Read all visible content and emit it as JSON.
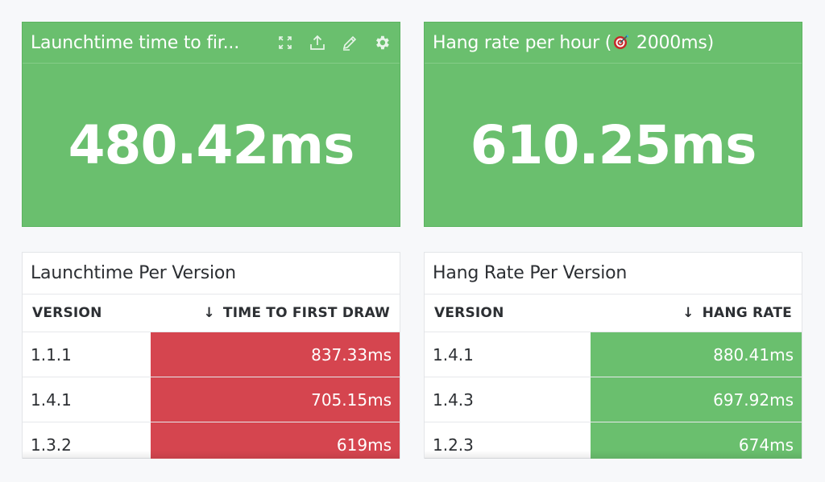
{
  "colors": {
    "green": "#6abf6e",
    "red": "#d5454f",
    "background": "#f7f8fa"
  },
  "widgets": {
    "launch_stat": {
      "title": "Launchtime time to fir...",
      "value": "480.42ms",
      "icons": [
        "expand-icon",
        "export-icon",
        "edit-icon",
        "gear-icon"
      ]
    },
    "hang_stat": {
      "title_prefix": "Hang rate per hour (",
      "title_icon": "target-icon",
      "title_suffix": " 2000ms)",
      "value": "610.25ms"
    },
    "launch_table": {
      "title": "Launchtime Per Version",
      "columns": [
        "VERSION",
        "TIME TO FIRST DRAW"
      ],
      "sort_icon": "↓",
      "rows": [
        {
          "version": "1.1.1",
          "value": "837.33ms"
        },
        {
          "version": "1.4.1",
          "value": "705.15ms"
        },
        {
          "version": "1.3.2",
          "value": "619ms"
        }
      ]
    },
    "hang_table": {
      "title": "Hang Rate Per Version",
      "columns": [
        "VERSION",
        "HANG RATE"
      ],
      "sort_icon": "↓",
      "rows": [
        {
          "version": "1.4.1",
          "value": "880.41ms"
        },
        {
          "version": "1.4.3",
          "value": "697.92ms"
        },
        {
          "version": "1.2.3",
          "value": "674ms"
        }
      ]
    }
  }
}
